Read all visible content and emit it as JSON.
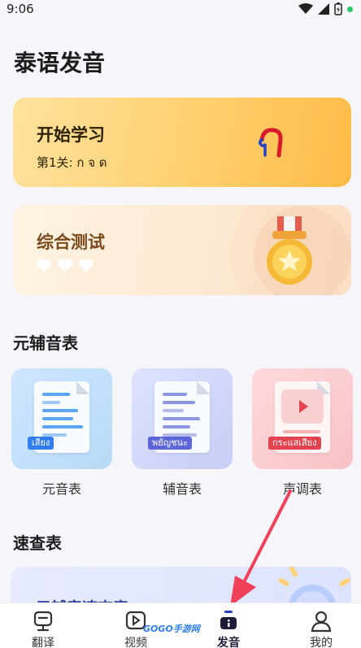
{
  "status": {
    "time": "9:06"
  },
  "page": {
    "title": "泰语发音"
  },
  "learn_card": {
    "title": "开始学习",
    "subtitle": "第1关: ก จ ด",
    "glyph": "ก"
  },
  "test_card": {
    "title": "综合测试",
    "hearts": 3
  },
  "chart_section": {
    "title": "元辅音表"
  },
  "tiles": [
    {
      "label": "元音表",
      "tag": "เสียง",
      "tag_color": "#2f7df0"
    },
    {
      "label": "辅音表",
      "tag": "พยัญชนะ",
      "tag_color": "#5b66d8"
    },
    {
      "label": "声调表",
      "tag": "กระแสเสียง",
      "tag_color": "#e2434e"
    }
  ],
  "quick_section": {
    "title": "速查表",
    "card_title": "元辅音速查表"
  },
  "nav": {
    "items": [
      {
        "label": "翻译",
        "icon": "translate-icon"
      },
      {
        "label": "视频",
        "icon": "video-icon"
      },
      {
        "label": "发音",
        "icon": "pronunciation-icon",
        "active": true
      },
      {
        "label": "我的",
        "icon": "profile-icon"
      }
    ]
  },
  "watermark": {
    "text": "GOGO手游网"
  },
  "colors": {
    "accent": "#ffbb47",
    "brand_dark": "#1d1d3a",
    "arrow": "#f0405a"
  }
}
